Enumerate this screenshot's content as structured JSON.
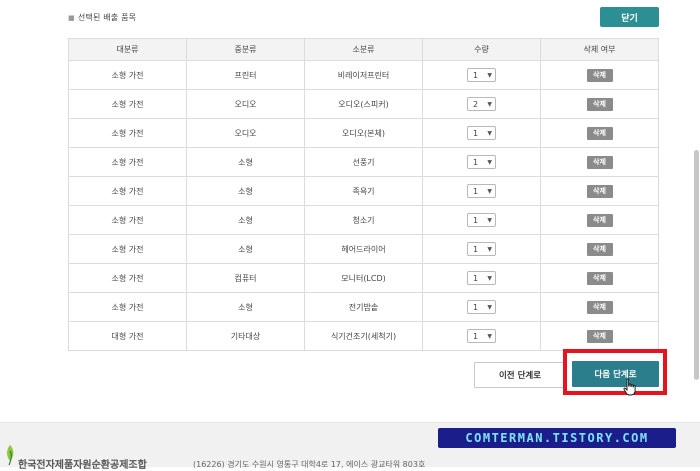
{
  "section_title": "선택된 배출 품목",
  "close_label": "닫기",
  "columns": [
    "대분류",
    "중분류",
    "소분류",
    "수량",
    "삭제 여부"
  ],
  "rows": [
    {
      "major": "소형 가전",
      "middle": "프린터",
      "minor": "비레이저프린터",
      "qty": "1",
      "delete": "삭제"
    },
    {
      "major": "소형 가전",
      "middle": "오디오",
      "minor": "오디오(스피커)",
      "qty": "2",
      "delete": "삭제"
    },
    {
      "major": "소형 가전",
      "middle": "오디오",
      "minor": "오디오(본체)",
      "qty": "1",
      "delete": "삭제"
    },
    {
      "major": "소형 가전",
      "middle": "소형",
      "minor": "선풍기",
      "qty": "1",
      "delete": "삭제"
    },
    {
      "major": "소형 가전",
      "middle": "소형",
      "minor": "족욕기",
      "qty": "1",
      "delete": "삭제"
    },
    {
      "major": "소형 가전",
      "middle": "소형",
      "minor": "청소기",
      "qty": "1",
      "delete": "삭제"
    },
    {
      "major": "소형 가전",
      "middle": "소형",
      "minor": "헤어드라이어",
      "qty": "1",
      "delete": "삭제"
    },
    {
      "major": "소형 가전",
      "middle": "컴퓨터",
      "minor": "모니터(LCD)",
      "qty": "1",
      "delete": "삭제"
    },
    {
      "major": "소형 가전",
      "middle": "소형",
      "minor": "전기밥솥",
      "qty": "1",
      "delete": "삭제"
    },
    {
      "major": "대형 가전",
      "middle": "기타대상",
      "minor": "식기건조기(세척기)",
      "qty": "1",
      "delete": "삭제"
    }
  ],
  "prev_label": "이전 단계로",
  "next_label": "다음 단계로",
  "footer": {
    "org": "한국전자제품자원순환공제조합",
    "address": "(16226) 경기도 수원시 영통구 대학4로 17, 에이스 광교타워 803호"
  },
  "watermark": "COMTERMAN.TISTORY.COM",
  "colors": {
    "accent": "#2b8f94",
    "next": "#2b7f8c",
    "highlight": "#e8141d",
    "delete": "#8b8b8b"
  },
  "icons": {
    "cursor": "hand-pointer-icon",
    "logo": "leaf-logo-icon"
  }
}
